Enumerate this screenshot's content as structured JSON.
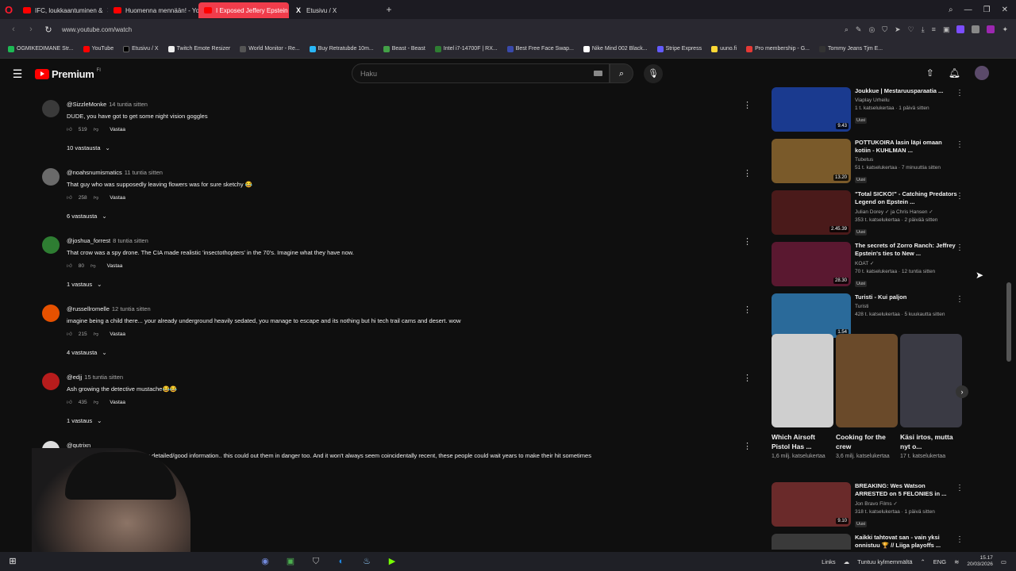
{
  "tabs": [
    {
      "title": "IFC, loukkaantuminen &",
      "icon": "youtube-icon",
      "active": false
    },
    {
      "title": "Huomenna mennään! - Yo",
      "icon": "youtube-icon",
      "active": false
    },
    {
      "title": "I Exposed Jeffery Epstein",
      "icon": "youtube-icon",
      "active": true
    },
    {
      "title": "Etusivu / X",
      "icon": "x-icon",
      "active": false
    }
  ],
  "address": {
    "url": "www.youtube.com/watch"
  },
  "bookmarks": [
    "OGMIKEDIMANE Str...",
    "YouTube",
    "Etusivu / X",
    "Twitch Emote Resizer",
    "World Monitor - Re...",
    "Buy Retratubde 10m...",
    "Beast - Beast",
    "Intel i7-14700F | RX...",
    "Best Free Face Swap...",
    "Nike Mind 002 Black...",
    "Stripe Express",
    "uuno.fi",
    "Pro membership - G...",
    "Tommy Jeans Tjm E..."
  ],
  "header": {
    "brand": "Premium",
    "region": "FI",
    "search_placeholder": "Haku"
  },
  "comments": [
    {
      "author": "@SizzleMonke",
      "ago": "14 tuntia sitten",
      "text": "DUDE, you have got to get some night vision goggles",
      "likes": "519",
      "reply": "Vastaa",
      "replies": "10 vastausta",
      "color": "#3a3a3a"
    },
    {
      "author": "@noahsnumismatics",
      "ago": "11 tuntia sitten",
      "text": "That guy who was supposedly leaving flowers was for sure sketchy 😂",
      "likes": "258",
      "reply": "Vastaa",
      "replies": "6 vastausta",
      "color": "#6a6a6a"
    },
    {
      "author": "@joshua_forrest",
      "ago": "8 tuntia sitten",
      "text": "That crow was a spy drone. The CIA made realistic 'insectothopters' in the 70's. Imagine what they have now.",
      "likes": "80",
      "reply": "Vastaa",
      "replies": "1 vastaus",
      "color": "#2e7d32"
    },
    {
      "author": "@russellromelle",
      "ago": "12 tuntia sitten",
      "text": "imagine being a child there... your already underground heavily sedated, you manage to escape and its nothing but hi tech trail cams and desert. wow",
      "likes": "215",
      "reply": "Vastaa",
      "replies": "4 vastausta",
      "color": "#e65100"
    },
    {
      "author": "@edjj",
      "ago": "15 tuntia sitten",
      "text": "Ash growing the detective mustache😂😂",
      "likes": "435",
      "reply": "Vastaa",
      "replies": "1 vastaus",
      "color": "#b71c1c"
    },
    {
      "author": "@qutrixn",
      "ago": "",
      "text": "the faces of those who give you detailed/good information.. this could out them in danger too. And it won't always seem coincidentally recent, these people could wait years to make their hit sometimes",
      "likes": "",
      "reply": "",
      "replies": "",
      "color": "#ddd"
    }
  ],
  "sidebar": [
    {
      "title": "Joukkue | Mestaruusparaatia ...",
      "channel": "Viaplay Urheilu",
      "meta": "1 t. katselukertaa · 1 päivä sitten",
      "badge": "Uusi",
      "duration": "9.43",
      "thumb": "#1a3a8f"
    },
    {
      "title": "POTTUKOIRA lasin läpi omaan kotiin - KUHLMAN ...",
      "channel": "Tubetus",
      "meta": "51 t. katselukertaa · 7 minuuttia sitten",
      "badge": "Uusi",
      "duration": "13.20",
      "thumb": "#7a5a2a"
    },
    {
      "title": "\"Total SICKO!\" - Catching Predators Legend on Epstein ...",
      "channel": "Julian Dorey ✓ ja Chris Hansen ✓",
      "meta": "353 t. katselukertaa · 2 päivää sitten",
      "badge": "Uusi",
      "duration": "2.45.39",
      "thumb": "#4a1a1a"
    },
    {
      "title": "The secrets of Zorro Ranch: Jeffrey Epstein's ties to New ...",
      "channel": "KOAT ✓",
      "meta": "70 t. katselukertaa · 12 tuntia sitten",
      "badge": "Uusi",
      "duration": "28.30",
      "thumb": "#5a1830"
    },
    {
      "title": "Turisti - Kui paljon",
      "channel": "Turisti",
      "meta": "428 t. katselukertaa · 5 kuukautta sitten",
      "badge": "",
      "duration": "1.54",
      "thumb": "#2a6a9a"
    },
    {
      "title": "BREAKING: Wes Watson ARRESTED on 5 FELONIES in ...",
      "channel": "Jon Bravo Films ✓",
      "meta": "318 t. katselukertaa · 1 päivä sitten",
      "badge": "Uusi",
      "duration": "9.10",
      "thumb": "#6a2a2a"
    },
    {
      "title": "Kaikki tahtovat san - vain yksi onnistuu 🏆 // Liiga playoffs ...",
      "channel": "",
      "meta": "",
      "badge": "",
      "duration": "",
      "thumb": "#3a3a3a"
    }
  ],
  "shorts": [
    {
      "title": "Which Airsoft Pistol Has ...",
      "views": "1,6 milj. katselukertaa",
      "thumb": "#cfcfcf"
    },
    {
      "title": "Cooking for the crew",
      "views": "3,6 milj. katselukertaa",
      "thumb": "#6a4a2a"
    },
    {
      "title": "Käsi irtos, mutta nyt o...",
      "views": "17 t. katselukertaa",
      "thumb": "#3a3a44"
    }
  ],
  "taskbar": {
    "links": "Links",
    "weather": "Tuntuu kylmemmältä",
    "lang": "ENG",
    "time": "15.17",
    "date": "20/03/2026"
  }
}
